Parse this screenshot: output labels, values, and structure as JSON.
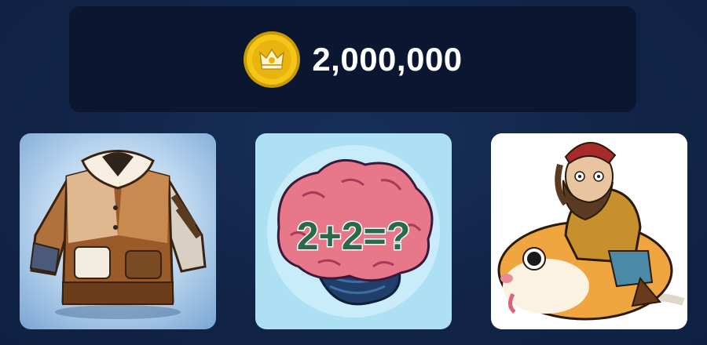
{
  "balance": {
    "amount": "2,000,000",
    "coin_icon": "gold-crown-coin-icon",
    "coin_color": "#f5c518"
  },
  "cards": [
    {
      "name": "fur-coat-card",
      "image": "patchwork-fur-coat"
    },
    {
      "name": "brain-puzzle-card",
      "image": "brain-math-puzzle",
      "puzzle_text": "2+2=?"
    },
    {
      "name": "hamster-rider-card",
      "image": "bearded-man-riding-hamster"
    }
  ],
  "colors": {
    "background": "#12264a",
    "panel": "#0b1631",
    "text": "#ffffff"
  }
}
